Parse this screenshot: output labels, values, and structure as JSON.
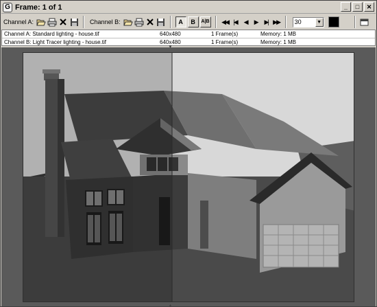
{
  "window": {
    "title": "Frame: 1 of 1",
    "app_icon_glyph": "G",
    "buttons": {
      "minimize": "_",
      "maximize": "□",
      "close": "✕"
    }
  },
  "toolbar": {
    "channel_a_label": "Channel A:",
    "channel_b_label": "Channel B:",
    "btn_a": "A",
    "btn_b": "B",
    "btn_ab": "A|B",
    "frame_value": "30",
    "icons": {
      "open": "open-icon",
      "print": "print-icon",
      "clear": "clear-icon",
      "save": "save-icon",
      "first": "first-frame-icon",
      "prev_key": "prev-key-icon",
      "prev": "prev-frame-icon",
      "play": "play-icon",
      "next": "next-frame-icon",
      "next_key": "next-key-icon",
      "last": "last-frame-icon",
      "color": "color-swatch"
    }
  },
  "channels": [
    {
      "name": "Channel A:  Standard lighting - house.tif",
      "size": "640x480",
      "frames": "1 Frame(s)",
      "memory": "Memory: 1 MB"
    },
    {
      "name": "Channel B:  Light Tracer lighting - house.tif",
      "size": "640x480",
      "frames": "1 Frame(s)",
      "memory": "Memory: 1 MB"
    }
  ],
  "colors": {
    "swatch": "#000000",
    "background": "#d4d0c8"
  }
}
